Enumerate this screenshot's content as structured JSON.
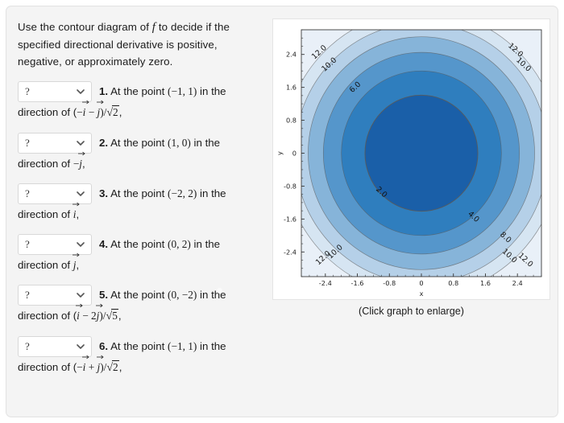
{
  "prompt": {
    "line1_a": "Use the contour diagram of ",
    "line1_f": "f",
    "line1_b": " to decide if the specified directional derivative is positive, negative, or approximately zero."
  },
  "select": {
    "value": "?",
    "icon": "chevron-down-icon"
  },
  "questions": [
    {
      "num": "1.",
      "head": "At the point ",
      "point": "(−1, 1)",
      "head_tail": " in the",
      "tail_prefix": "direction of (",
      "vec1_sign": "−",
      "vec1": "i",
      "mid": " − ",
      "vec2_sign": "",
      "vec2": "j",
      "tail_mid": ")/",
      "root": "2",
      "tail_end": ","
    },
    {
      "num": "2.",
      "head": "At the point ",
      "point": "(1, 0)",
      "head_tail": " in the",
      "tail_prefix": "direction of ",
      "vec1_sign": "−",
      "vec1": "j",
      "mid": "",
      "vec2_sign": "",
      "vec2": "",
      "tail_mid": "",
      "root": "",
      "tail_end": ","
    },
    {
      "num": "3.",
      "head": "At the point ",
      "point": "(−2, 2)",
      "head_tail": " in the",
      "tail_prefix": "direction of ",
      "vec1_sign": "",
      "vec1": "i",
      "mid": "",
      "vec2_sign": "",
      "vec2": "",
      "tail_mid": "",
      "root": "",
      "tail_end": ","
    },
    {
      "num": "4.",
      "head": "At the point ",
      "point": "(0, 2)",
      "head_tail": " in the",
      "tail_prefix": "direction of ",
      "vec1_sign": "",
      "vec1": "j",
      "mid": "",
      "vec2_sign": "",
      "vec2": "",
      "tail_mid": "",
      "root": "",
      "tail_end": ","
    },
    {
      "num": "5.",
      "head": "At the point ",
      "point": "(0, −2)",
      "head_tail": " in the",
      "tail_prefix": "direction of (",
      "vec1_sign": "",
      "vec1": "i",
      "mid": " − 2",
      "vec2_sign": "",
      "vec2": "j",
      "tail_mid": ")/",
      "root": "5",
      "tail_end": ","
    },
    {
      "num": "6.",
      "head": "At the point ",
      "point": "(−1, 1)",
      "head_tail": " in the",
      "tail_prefix": "direction of (",
      "vec1_sign": "−",
      "vec1": "i",
      "mid": " + ",
      "vec2_sign": "",
      "vec2": "j",
      "tail_mid": ")/",
      "root": "2",
      "tail_end": ","
    }
  ],
  "graph": {
    "caption": "(Click graph to enlarge)"
  },
  "chart_data": {
    "type": "heatmap",
    "subtype": "filled-contour",
    "title": "",
    "xlabel": "x",
    "ylabel": "y",
    "xlim": [
      -3.0,
      3.0
    ],
    "ylim": [
      -3.0,
      3.0
    ],
    "xticks": [
      "-2.4",
      "-1.6",
      "-0.8",
      "0",
      "0.8",
      "1.6",
      "2.4"
    ],
    "xtick_values": [
      -2.4,
      -1.6,
      -0.8,
      0,
      0.8,
      1.6,
      2.4
    ],
    "yticks": [
      "2.4",
      "1.6",
      "0.8",
      "0",
      "-0.8",
      "-1.6",
      "-2.4"
    ],
    "ytick_values": [
      2.4,
      1.6,
      0.8,
      0,
      -0.8,
      -1.6,
      -2.4
    ],
    "grid": false,
    "legend": "none",
    "function": "f(x,y) = x^2 + y^2 (concentric circular level curves centered at origin)",
    "contour_levels": [
      2.0,
      4.0,
      6.0,
      8.0,
      10.0,
      12.0
    ],
    "level_radii": [
      1.41,
      2.0,
      2.45,
      2.83,
      3.16,
      3.46
    ],
    "band_colors": [
      "#1a5fa8",
      "#1f6cb5",
      "#2f7ebe",
      "#5596cb",
      "#86b4d9",
      "#b5d0e8",
      "#d6e5f2",
      "#e9f0f8"
    ],
    "contour_line_color": "#5a5a5a",
    "labels": [
      {
        "text": "12.0",
        "x": -2.55,
        "y": 2.45,
        "rot": -42
      },
      {
        "text": "10.0",
        "x": -2.3,
        "y": 2.15,
        "rot": -42
      },
      {
        "text": "6.0",
        "x": -1.65,
        "y": 1.6,
        "rot": -42
      },
      {
        "text": "12.0",
        "x": 2.35,
        "y": 2.5,
        "rot": 42
      },
      {
        "text": "10.0",
        "x": 2.55,
        "y": 2.15,
        "rot": 42
      },
      {
        "text": "2.0",
        "x": -1.0,
        "y": -0.95,
        "rot": 42
      },
      {
        "text": "4.0",
        "x": 1.3,
        "y": -1.55,
        "rot": 42
      },
      {
        "text": "8.0",
        "x": 2.1,
        "y": -2.05,
        "rot": 42
      },
      {
        "text": "10.0",
        "x": 2.2,
        "y": -2.5,
        "rot": 42
      },
      {
        "text": "12.0",
        "x": 2.6,
        "y": -2.6,
        "rot": 42
      },
      {
        "text": "12.0",
        "x": -2.45,
        "y": -2.55,
        "rot": -42
      },
      {
        "text": "10.0",
        "x": -2.15,
        "y": -2.4,
        "rot": -42
      }
    ]
  }
}
